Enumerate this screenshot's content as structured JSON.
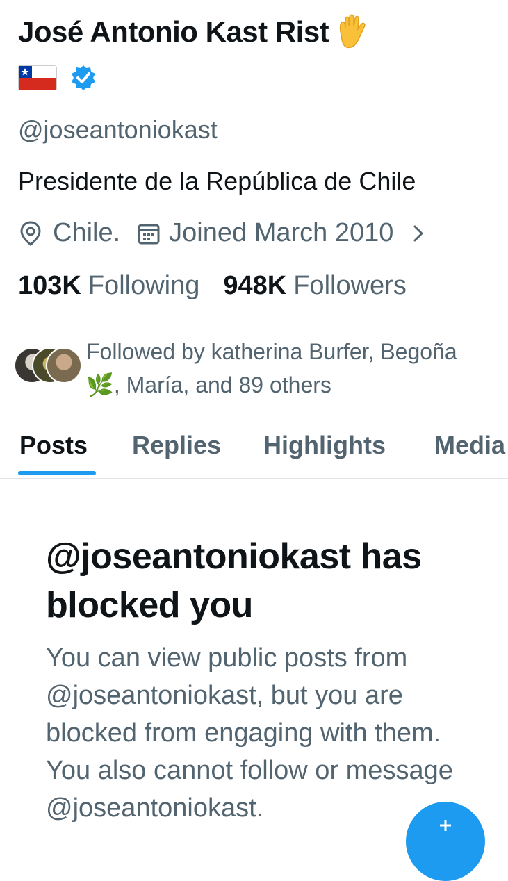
{
  "profile": {
    "display_name": "José Antonio Kast Rist",
    "handle": "@joseantoniokast",
    "bio": "Presidente de la República de Chile",
    "location": "Chile.",
    "joined": "Joined March 2010",
    "icons": {
      "hand": "raised-hand-icon",
      "flag": "chile-flag-icon",
      "verified": "verified-badge-icon",
      "location": "location-pin-icon",
      "calendar": "calendar-icon",
      "chevron": "chevron-right-icon"
    }
  },
  "stats": {
    "following_count": "103K",
    "following_label": "Following",
    "followers_count": "948K",
    "followers_label": "Followers"
  },
  "followed_by": {
    "text": "Followed by katherina Burfer, Begoña 🌿, María, and 89 others"
  },
  "tabs": [
    {
      "label": "Posts",
      "active": true
    },
    {
      "label": "Replies",
      "active": false
    },
    {
      "label": "Highlights",
      "active": false
    },
    {
      "label": "Media",
      "active": false
    }
  ],
  "blocked": {
    "title": "@joseantoniokast has blocked you",
    "description": "You can view public posts from @joseantoniokast, but you are blocked from engaging with them. You also cannot follow or message @joseantoniokast."
  },
  "compose": {
    "icon": "plus-icon"
  },
  "colors": {
    "accent": "#1d9bf0",
    "primary_text": "#0f1419",
    "secondary_text": "#536471"
  }
}
